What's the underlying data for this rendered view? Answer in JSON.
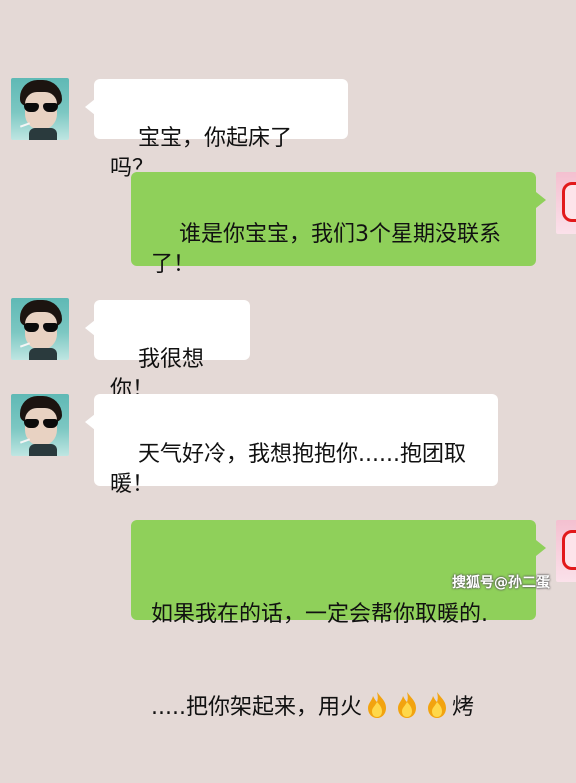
{
  "messages": [
    {
      "side": "left",
      "text": "宝宝，你起床了吗？"
    },
    {
      "side": "right",
      "text": "谁是你宝宝，我们3个星期没联系了！"
    },
    {
      "side": "left",
      "text": "我很想你！"
    },
    {
      "side": "left",
      "text": "天气好冷，我想抱抱你......抱团取暖！"
    },
    {
      "side": "right",
      "text_line1": "如果我在的话，一定会帮你取暖的.",
      "text_line2_prefix": ".....把你架起来，用火",
      "text_line2_suffix": "烤"
    }
  ],
  "icons": {
    "left_avatar": "man-sunglasses-avatar",
    "right_avatar": "pink-avatar",
    "fire": "fire-emoji"
  },
  "colors": {
    "background": "#e4d9d6",
    "left_bubble": "#ffffff",
    "right_bubble": "#8fd05a"
  },
  "watermark": "搜狐号@孙二蛋"
}
